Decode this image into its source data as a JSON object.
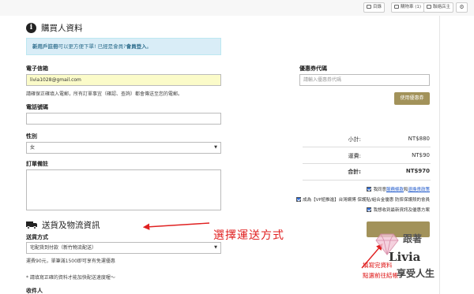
{
  "topbar": {
    "items": [
      {
        "icon": "list-icon",
        "label": "目錄"
      },
      {
        "icon": "cart-icon",
        "label": "購物車 (1)"
      },
      {
        "icon": "chat-icon",
        "label": "聯絡店主"
      },
      {
        "icon": "gear-icon",
        "label": ""
      }
    ]
  },
  "buyer": {
    "title": "購買人資料",
    "alert_prefix": "新用戶註冊",
    "alert_middle": "可以更方便下單! 已經是會員?",
    "alert_link": "會員登入",
    "alert_end": "。",
    "email_label": "電子信箱",
    "email_value": "livia1028@gmail.com",
    "email_help": "請確保正確填入電郵，所有訂單事宜（確認、查詢）都會傳送至您的電郵。",
    "phone_label": "電話號碼",
    "phone_value": "",
    "gender_label": "性別",
    "gender_value": "女",
    "note_label": "訂單備註"
  },
  "coupon": {
    "label": "優惠券代碼",
    "placeholder": "請輸入優惠券代碼",
    "button": "使用優惠券"
  },
  "summary": {
    "subtotal_label": "小計:",
    "subtotal_value": "NT$880",
    "shipping_label": "運費:",
    "shipping_value": "NT$90",
    "total_label": "合計:",
    "total_value": "NT$970"
  },
  "agreements": {
    "terms_prefix": "我同意",
    "terms_link1": "服務條款",
    "terms_mid": "和",
    "terms_link2": "退換貨政策",
    "vip": "成為【VP妞推進】台灣網博 保護貼/組合金優惠 防摔保護殼的會員",
    "promo": "我想收到最新資訊及優惠方案"
  },
  "shipping": {
    "title": "送貨及物流資訊",
    "method_label": "送貨方式",
    "method_value": "宅配貨到付款（新竹物流配送）",
    "method_help": "運費90元，單筆滿1500即可享有免運優惠",
    "note": "* 請填寫正確的資料才能加快配送速度喔～",
    "recipient_label": "收件人"
  },
  "annotations": {
    "red_text": "選擇運送方式",
    "note_line1": "填寫完資料",
    "note_line2": "點選前往結帳",
    "watermark1": "跟著",
    "watermark2": "Livia",
    "watermark3": "享受人生",
    "color": "#e02020"
  }
}
